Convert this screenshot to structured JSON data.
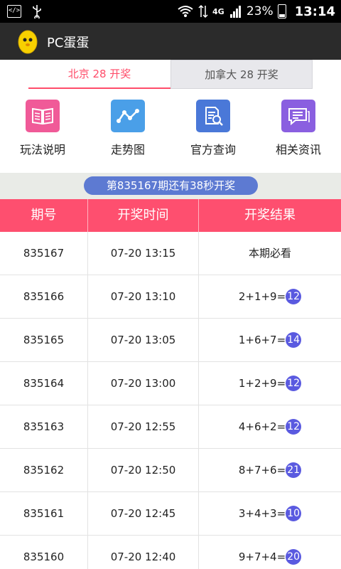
{
  "status_bar": {
    "battery_percent": "23%",
    "time": "13:14"
  },
  "app": {
    "title": "PC蛋蛋"
  },
  "tabs": [
    {
      "label": "北京 28 开奖",
      "active": true
    },
    {
      "label": "加拿大 28 开奖",
      "active": false
    }
  ],
  "menu": [
    {
      "label": "玩法说明",
      "icon": "book-icon",
      "color": "#f05a98"
    },
    {
      "label": "走势图",
      "icon": "trend-chart-icon",
      "color": "#4a9fe8"
    },
    {
      "label": "官方查询",
      "icon": "document-search-icon",
      "color": "#4a78d8"
    },
    {
      "label": "相关资讯",
      "icon": "news-chat-icon",
      "color": "#8a5fe0"
    }
  ],
  "countdown": "第835167期还有38秒开奖",
  "table": {
    "headers": [
      "期号",
      "开奖时间",
      "开奖结果"
    ],
    "rows": [
      {
        "period": "835167",
        "time": "07-20 13:15",
        "expr": "本期必看",
        "sum": ""
      },
      {
        "period": "835166",
        "time": "07-20 13:10",
        "expr": "2+1+9=",
        "sum": "12"
      },
      {
        "period": "835165",
        "time": "07-20 13:05",
        "expr": "1+6+7=",
        "sum": "14"
      },
      {
        "period": "835164",
        "time": "07-20 13:00",
        "expr": "1+2+9=",
        "sum": "12"
      },
      {
        "period": "835163",
        "time": "07-20 12:55",
        "expr": "4+6+2=",
        "sum": "12"
      },
      {
        "period": "835162",
        "time": "07-20 12:50",
        "expr": "8+7+6=",
        "sum": "21"
      },
      {
        "period": "835161",
        "time": "07-20 12:45",
        "expr": "3+4+3=",
        "sum": "10"
      },
      {
        "period": "835160",
        "time": "07-20 12:40",
        "expr": "9+7+4=",
        "sum": "20"
      }
    ]
  },
  "colors": {
    "accent": "#fe4f6f",
    "ball": "#5a5ae0",
    "countdown": "#5d7ad2"
  }
}
